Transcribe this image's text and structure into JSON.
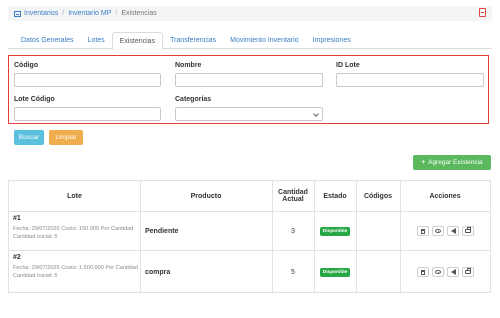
{
  "breadcrumb": {
    "items": [
      "Inventarios",
      "Inventario MP",
      "Existencias"
    ]
  },
  "tabs": [
    "Datos Generales",
    "Lotes",
    "Existencias",
    "Transferencias",
    "Movimiento Inventario",
    "Impresiones"
  ],
  "active_tab": "Existencias",
  "filters": {
    "codigo_label": "Código",
    "nombre_label": "Nombre",
    "id_lote_label": "ID Lote",
    "lote_codigo_label": "Lote Código",
    "categorias_label": "Categorías"
  },
  "buttons": {
    "buscar": "Buscar",
    "limpiar": "Limpiar",
    "agregar": "Agregar Existencia"
  },
  "table": {
    "headers": {
      "lote": "Lote",
      "producto": "Producto",
      "cantidad_actual": "Cantidad Actual",
      "estado": "Estado",
      "codigos": "Códigos",
      "acciones": "Acciones"
    },
    "rows": [
      {
        "lote_id": "#1",
        "lote_meta": "Fecha: 29/07/2025 Costo: 150.000 Por Cantidad Cantidad Inicial: 5",
        "producto": "Pendiente",
        "cantidad": "3",
        "estado": "Disponible"
      },
      {
        "lote_id": "#2",
        "lote_meta": "Fecha: 29/07/2025 Costo: 1.500.000 Por Cantidad Cantidad Inicial: 5",
        "producto": "compra",
        "cantidad": "5",
        "estado": "Disponible"
      }
    ]
  },
  "colors": {
    "accent": "#3b7dc4",
    "highlight_border": "#e53b3b",
    "buscar": "#5bc0de",
    "limpiar": "#f0ad4e",
    "agregar": "#5cb85c",
    "badge": "#28a745"
  },
  "icons": {
    "breadcrumb": "list-icon",
    "pdf": "file-pdf-icon",
    "actions": [
      "trash-icon",
      "eye-icon",
      "megaphone-icon",
      "print-icon"
    ]
  }
}
